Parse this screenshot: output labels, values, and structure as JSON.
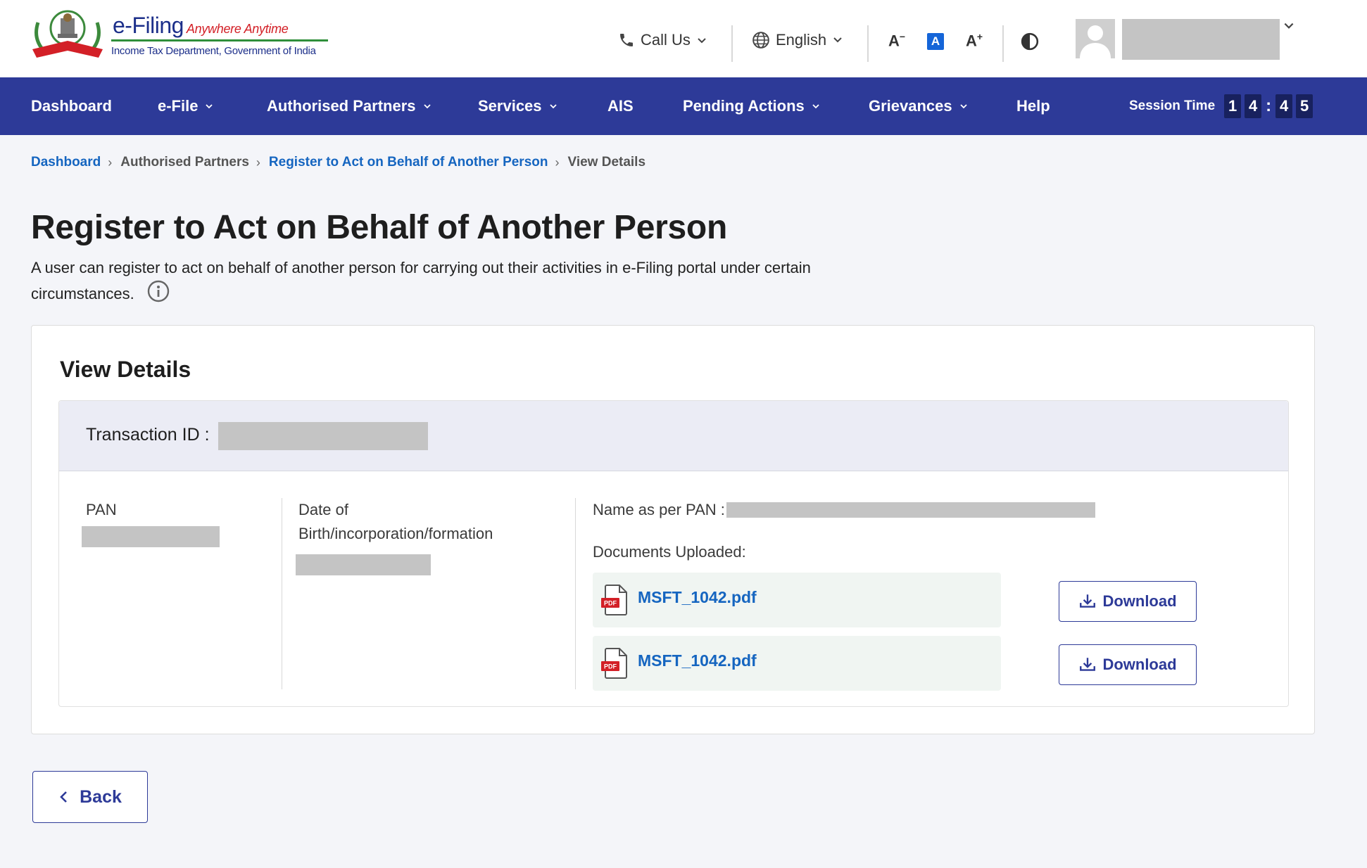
{
  "brand": {
    "title": "e-Filing",
    "tagline": "Anywhere Anytime",
    "subtitle": "Income Tax Department, Government of India",
    "emblem_label": "INCOME TAX DEPARTMENT"
  },
  "header": {
    "call_us": "Call Us",
    "language": "English",
    "font_decrease": "A",
    "font_normal": "A",
    "font_increase": "A"
  },
  "nav": {
    "items": [
      {
        "label": "Dashboard"
      },
      {
        "label": "e-File"
      },
      {
        "label": "Authorised Partners"
      },
      {
        "label": "Services"
      },
      {
        "label": "AIS"
      },
      {
        "label": "Pending Actions"
      },
      {
        "label": "Grievances"
      },
      {
        "label": "Help"
      }
    ],
    "session_label": "Session Time",
    "session_digits": [
      "1",
      "4",
      "4",
      "5"
    ],
    "session_colon": ":"
  },
  "breadcrumb": {
    "items": [
      "Dashboard",
      "Authorised Partners",
      "Register to Act on Behalf of Another Person",
      "View Details"
    ]
  },
  "page": {
    "title": "Register to Act on Behalf of Another Person",
    "description": "A user can register to act on behalf of another person for carrying out their activities in e-Filing portal under certain circumstances."
  },
  "details": {
    "card_title": "View Details",
    "transaction_label": "Transaction ID :",
    "pan_label": "PAN",
    "dob_label_line1": "Date of",
    "dob_label_line2": "Birth/incorporation/formation",
    "name_label": "Name as per PAN :",
    "documents_label": "Documents Uploaded:",
    "documents": [
      {
        "name": "MSFT_1042.pdf",
        "download_label": "Download",
        "icon_text": "PDF"
      },
      {
        "name": "MSFT_1042.pdf",
        "download_label": "Download",
        "icon_text": "PDF"
      }
    ]
  },
  "actions": {
    "back_label": "Back"
  },
  "colors": {
    "navbar": "#2d3a98",
    "link": "#1565c0",
    "accent_red": "#d32027"
  }
}
